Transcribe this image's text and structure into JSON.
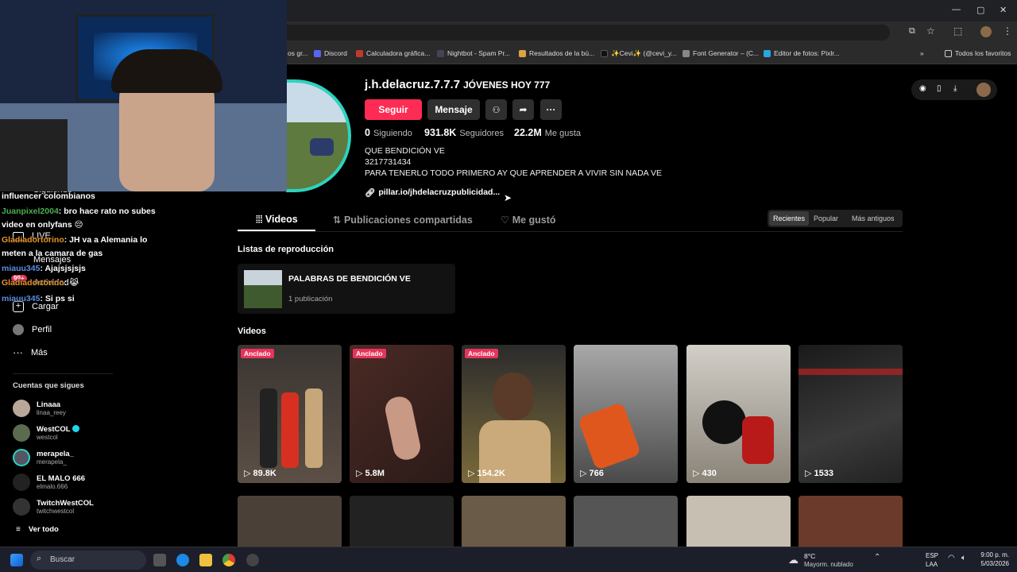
{
  "bookmarks": [
    {
      "label": "os gr..."
    },
    {
      "label": "Discord"
    },
    {
      "label": "Calculadora gráfica..."
    },
    {
      "label": "Nightbot - Spam Pr..."
    },
    {
      "label": "Resultados de la bú..."
    },
    {
      "label": "✨Cevi✨ (@cevi_y..."
    },
    {
      "label": "Font Generator – (C..."
    },
    {
      "label": "Editor de fotos: Pixlr..."
    },
    {
      "label": "Todos los favoritos"
    }
  ],
  "profile": {
    "username": "j.h.delacruz.7.7.7",
    "nickname": "JÓVENES HOY 777",
    "follow_label": "Seguir",
    "message_label": "Mensaje",
    "following_count": "0",
    "following_label": "Siguiendo",
    "followers_count": "931.8K",
    "followers_label": "Seguidores",
    "likes_count": "22.2M",
    "likes_label": "Me gusta",
    "bio1": "QUE BENDICIÓN VE",
    "bio2": "3217731434",
    "bio3": "PARA TENERLO TODO PRIMERO AY QUE APRENDER A VIVIR SIN NADA VE",
    "link": "pillar.io/jhdelacruzpublicidad..."
  },
  "tabs": {
    "videos": "Videos",
    "reposts": "Publicaciones compartidas",
    "liked": "Me gustó"
  },
  "sort": {
    "recent": "Recientes",
    "popular": "Popular",
    "oldest": "Más antiguos"
  },
  "playlists": {
    "heading": "Listas de reproducción",
    "title": "PALABRAS DE BENDICIÓN VE",
    "count": "1 publicación"
  },
  "videos_heading": "Videos",
  "pinned_label": "Anclado",
  "videos": [
    {
      "views": "89.8K"
    },
    {
      "views": "5.8M"
    },
    {
      "views": "154.2K"
    },
    {
      "views": "766"
    },
    {
      "views": "430"
    },
    {
      "views": "1533"
    }
  ],
  "sidebar": {
    "following": "Siguiendo",
    "live": "LIVE",
    "messages": "Mensajes",
    "activity": "Actividad",
    "badge": "99+",
    "upload": "Cargar",
    "profile": "Perfil",
    "more": "Más",
    "accounts_heading": "Cuentas que sigues",
    "see_all": "Ver todo"
  },
  "followed_accounts": [
    {
      "name": "Linaaa",
      "handle": "linaa_reey"
    },
    {
      "name": "WestCOL",
      "handle": "westcol"
    },
    {
      "name": "merapela_",
      "handle": "merapela_"
    },
    {
      "name": "EL MALO 666",
      "handle": "elmalo.666"
    },
    {
      "name": "TwitchWestCOL",
      "handle": "twitchwestcol"
    }
  ],
  "chat": [
    {
      "user": "",
      "user_color": "#ffffff",
      "text": "influencer colombianos"
    },
    {
      "user": "Juanpixel2004",
      "user_color": "#4caf50",
      "text": ": bro hace rato no subes"
    },
    {
      "user": "",
      "user_color": "#ffffff",
      "text": "video en onlyfans 😔"
    },
    {
      "user": "Gladiadortorino",
      "user_color": "#e8932a",
      "text": ": JH va a Alemania lo"
    },
    {
      "user": "",
      "user_color": "#ffffff",
      "text": "meten a la camara de gas"
    },
    {
      "user": "miauu345",
      "user_color": "#5b8de0",
      "text": ": Ajajsjsjsjs"
    },
    {
      "user": "Gladiadortorino",
      "user_color": "#e8932a",
      "text": ": 😹"
    },
    {
      "user": "miauu345",
      "user_color": "#5b8de0",
      "text": ": Si ps si"
    }
  ],
  "taskbar": {
    "search": "Buscar",
    "weather_temp": "8°C",
    "weather_desc": "Mayorm. nublado",
    "lang1": "ESP",
    "lang2": "LAA",
    "time": "9:00 p. m.",
    "date": "5/03/2026"
  },
  "colors": {
    "accent": "#fe2c55",
    "ring": "#2ad4c0"
  }
}
